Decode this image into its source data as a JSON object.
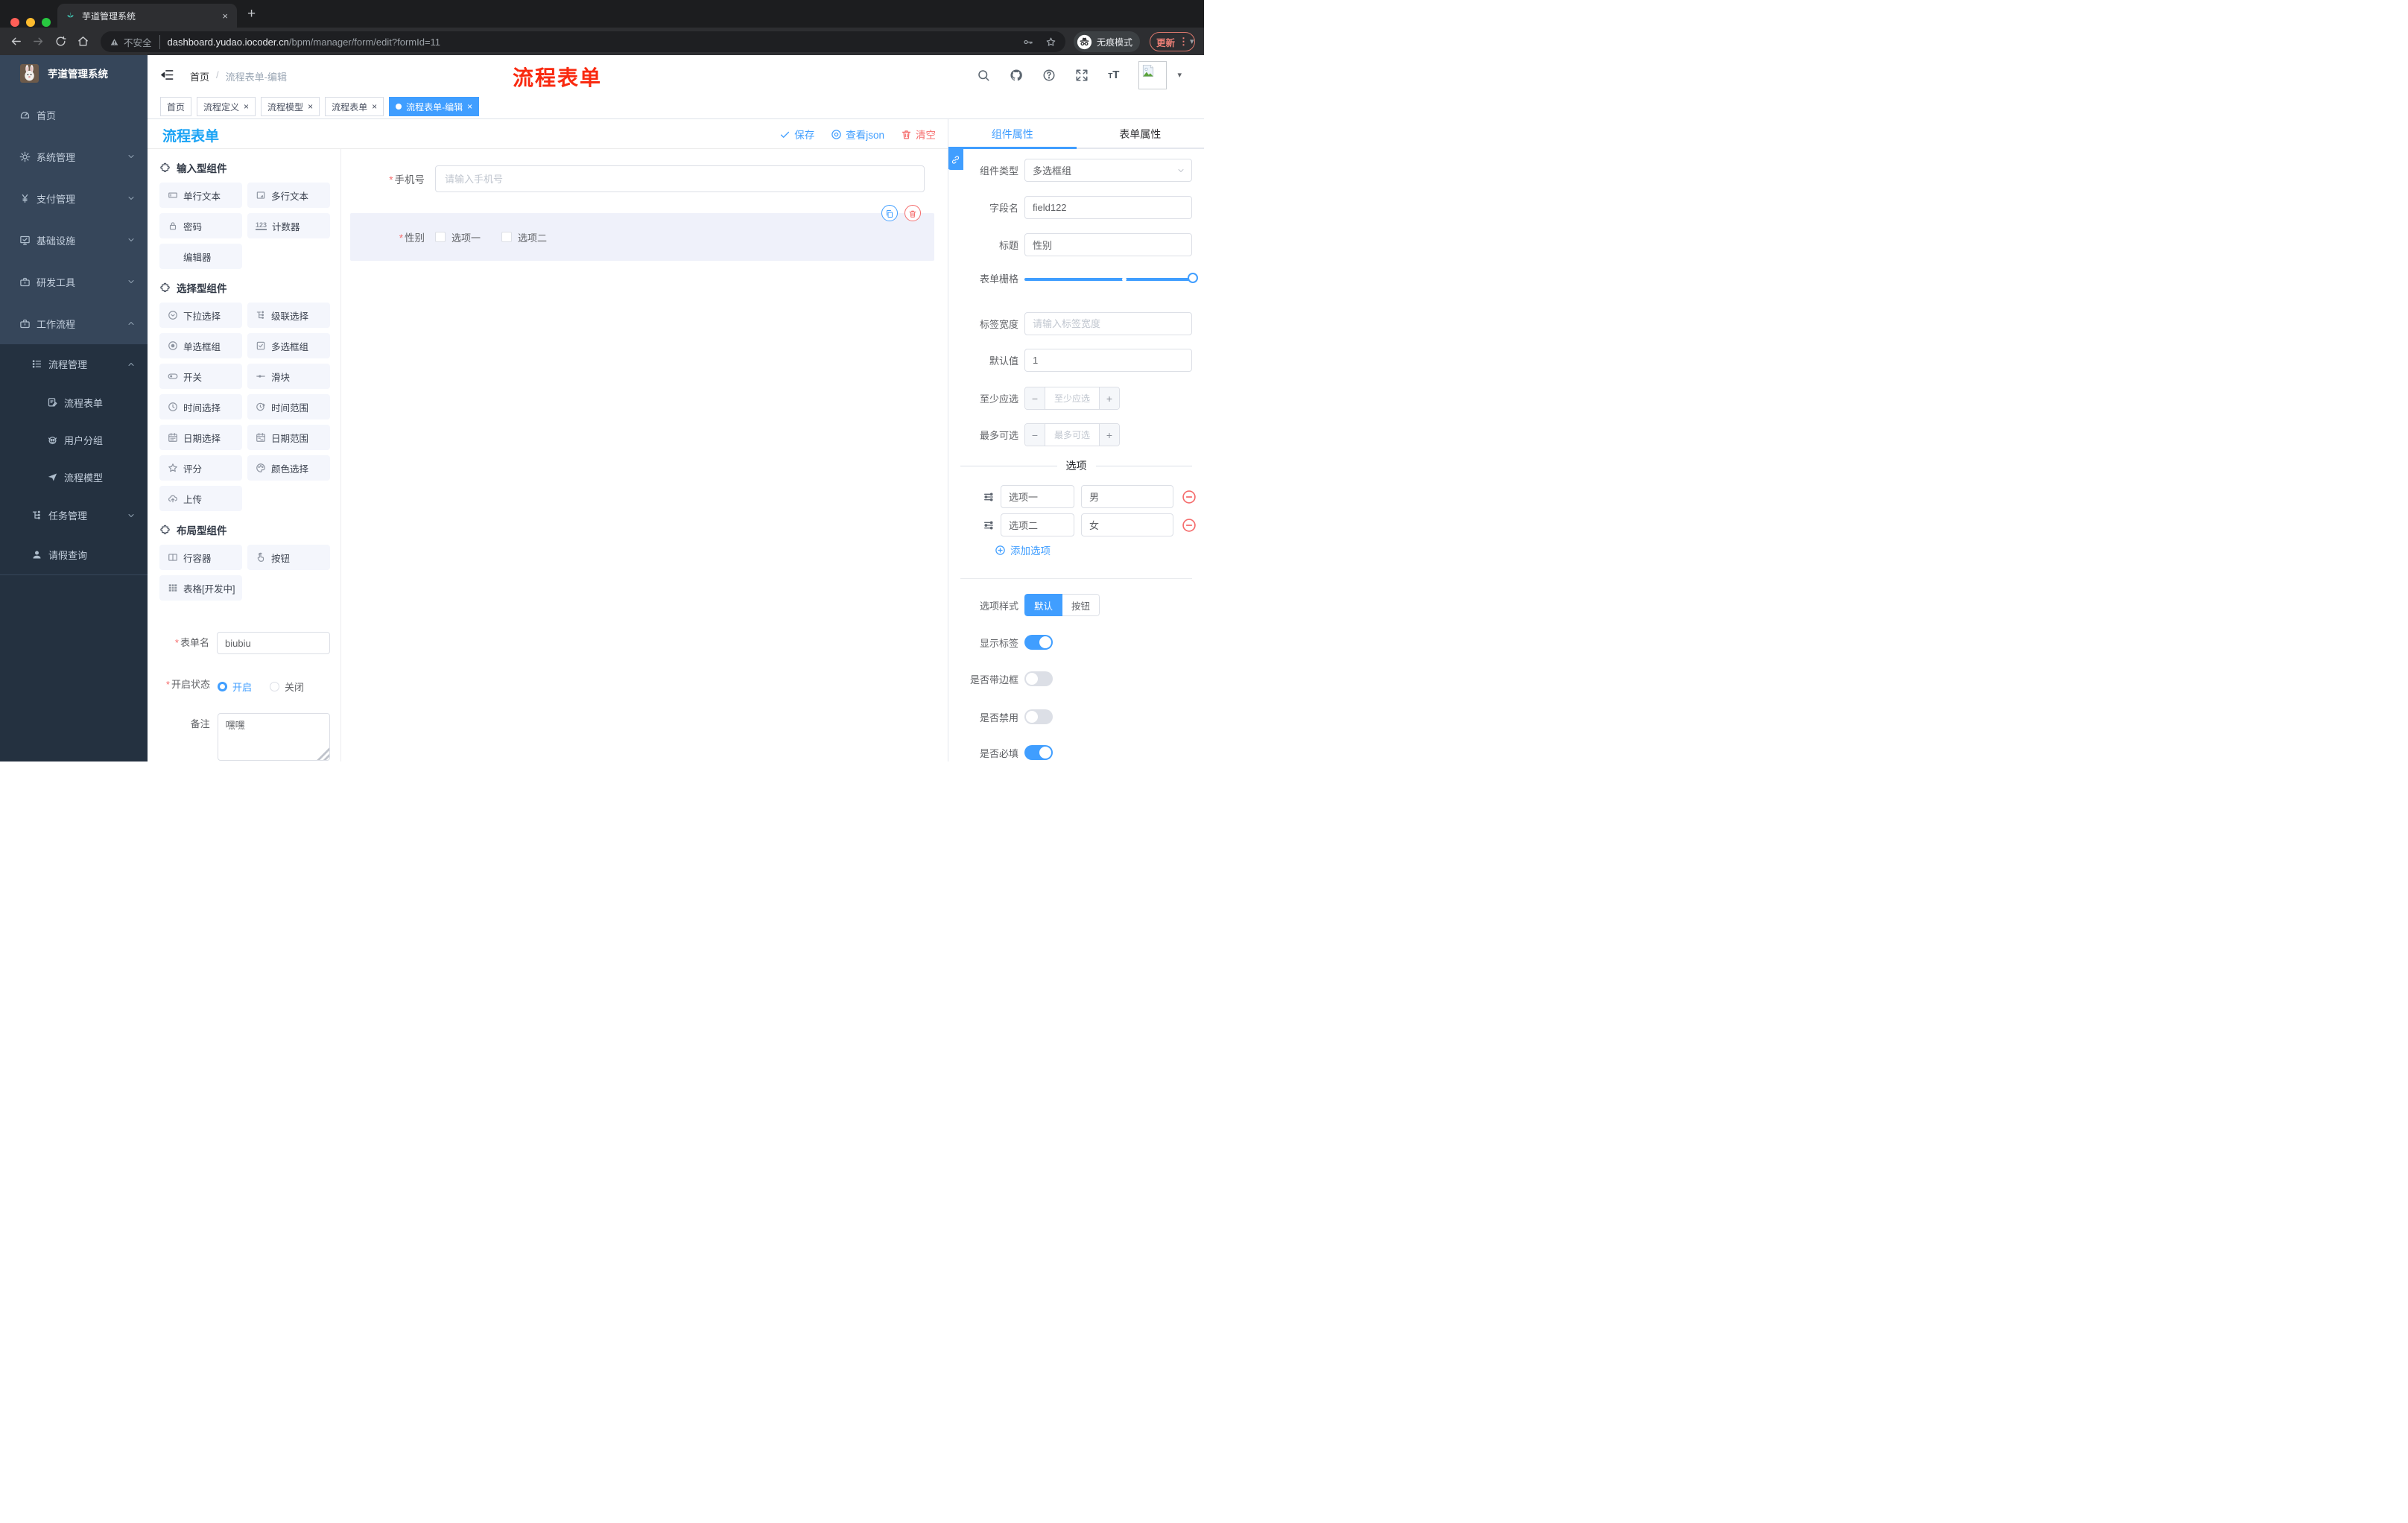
{
  "glyphs": {
    "close": "×",
    "caret": "▾",
    "sep": "/",
    "dots": "⋮",
    "newtab": "+"
  },
  "browser": {
    "tab_title": "芋道管理系统",
    "security_label": "不安全",
    "url_host": "dashboard.yudao.iocoder.cn",
    "url_path": "/bpm/manager/form/edit?formId=11",
    "incognito_label": "无痕模式",
    "update_label": "更新"
  },
  "sidebar": {
    "brand": "芋道管理系统",
    "top": [
      {
        "id": "home",
        "label": "首页",
        "icon": "dashboard"
      },
      {
        "id": "system",
        "label": "系统管理",
        "icon": "gear",
        "chevron": "down"
      },
      {
        "id": "pay",
        "label": "支付管理",
        "icon": "yen",
        "chevron": "down"
      },
      {
        "id": "infra",
        "label": "基础设施",
        "icon": "monitor",
        "chevron": "down"
      },
      {
        "id": "devtool",
        "label": "研发工具",
        "icon": "briefcase",
        "chevron": "down"
      },
      {
        "id": "workflow",
        "label": "工作流程",
        "icon": "briefcase",
        "chevron": "up"
      }
    ],
    "submenu": [
      {
        "id": "process-mgmt",
        "label": "流程管理",
        "icon": "listdots",
        "chevron": "up",
        "level": 1
      },
      {
        "id": "process-form",
        "label": "流程表单",
        "icon": "formdoc",
        "level": 2
      },
      {
        "id": "user-group",
        "label": "用户分组",
        "icon": "robot",
        "level": 2
      },
      {
        "id": "process-model",
        "label": "流程模型",
        "icon": "plane",
        "level": 2
      },
      {
        "id": "task-mgmt",
        "label": "任务管理",
        "icon": "tree",
        "chevron": "down",
        "level": 1
      },
      {
        "id": "leave-query",
        "label": "请假查询",
        "icon": "user",
        "level": 1
      }
    ]
  },
  "header": {
    "breadcrumb": {
      "root": "首页",
      "current": "流程表单-编辑"
    },
    "watermark": "流程表单"
  },
  "tags": {
    "tabs": [
      {
        "label": "首页"
      },
      {
        "label": "流程定义",
        "closable": true
      },
      {
        "label": "流程模型",
        "closable": true
      },
      {
        "label": "流程表单",
        "closable": true
      },
      {
        "label": "流程表单-编辑",
        "closable": true,
        "active": true
      }
    ]
  },
  "designer": {
    "title": "流程表单",
    "save_label": "保存",
    "view_json_label": "查看json",
    "clear_label": "清空"
  },
  "palette": {
    "sections": [
      {
        "title": "输入型组件",
        "items": [
          {
            "label": "单行文本",
            "icon": "input"
          },
          {
            "label": "多行文本",
            "icon": "textarea"
          },
          {
            "label": "密码",
            "icon": "lock"
          },
          {
            "label": "计数器",
            "icon": "counter"
          },
          {
            "label": "编辑器",
            "icon": "none"
          }
        ]
      },
      {
        "title": "选择型组件",
        "items": [
          {
            "label": "下拉选择",
            "icon": "selectdown"
          },
          {
            "label": "级联选择",
            "icon": "tree"
          },
          {
            "label": "单选框组",
            "icon": "radio"
          },
          {
            "label": "多选框组",
            "icon": "checkbox"
          },
          {
            "label": "开关",
            "icon": "switch"
          },
          {
            "label": "滑块",
            "icon": "sliderline"
          },
          {
            "label": "时间选择",
            "icon": "clock"
          },
          {
            "label": "时间范围",
            "icon": "clockrange"
          },
          {
            "label": "日期选择",
            "icon": "calendar"
          },
          {
            "label": "日期范围",
            "icon": "calrange"
          },
          {
            "label": "评分",
            "icon": "star"
          },
          {
            "label": "颜色选择",
            "icon": "palette"
          },
          {
            "label": "上传",
            "icon": "cloudup"
          }
        ]
      },
      {
        "title": "布局型组件",
        "items": [
          {
            "label": "行容器",
            "icon": "rowbox"
          },
          {
            "label": "按钮",
            "icon": "handclick"
          },
          {
            "label": "表格[开发中]",
            "icon": "tablegrid"
          }
        ]
      }
    ]
  },
  "meta": {
    "form_name_label": "表单名",
    "form_name_value": "biubiu",
    "status_label": "开启状态",
    "status_on": "开启",
    "status_off": "关闭",
    "remark_label": "备注",
    "remark_value": "嘿嘿"
  },
  "canvas": {
    "phone": {
      "label": "手机号",
      "placeholder": "请输入手机号"
    },
    "gender": {
      "label": "性别",
      "options": [
        "选项一",
        "选项二"
      ]
    }
  },
  "panel": {
    "tabs": {
      "component": "组件属性",
      "form": "表单属性"
    },
    "component_type_label": "组件类型",
    "component_type_value": "多选框组",
    "field_name_label": "字段名",
    "field_name_value": "field122",
    "title_label": "标题",
    "title_value": "性别",
    "grid_label": "表单栅格",
    "label_width_label": "标签宽度",
    "label_width_placeholder": "请输入标签宽度",
    "default_label": "默认值",
    "default_value": "1",
    "min_label": "至少应选",
    "min_placeholder": "至少应选",
    "max_label": "最多可选",
    "max_placeholder": "最多可选",
    "options_title": "选项",
    "option_rows": [
      {
        "label": "选项一",
        "value": "男"
      },
      {
        "label": "选项二",
        "value": "女"
      }
    ],
    "add_option_label": "添加选项",
    "style_label": "选项样式",
    "style_options": [
      "默认",
      "按钮"
    ],
    "style_selected": "默认",
    "toggles": [
      {
        "label": "显示标签",
        "on": true
      },
      {
        "label": "是否带边框",
        "on": false
      },
      {
        "label": "是否禁用",
        "on": false
      },
      {
        "label": "是否必填",
        "on": true
      }
    ]
  }
}
